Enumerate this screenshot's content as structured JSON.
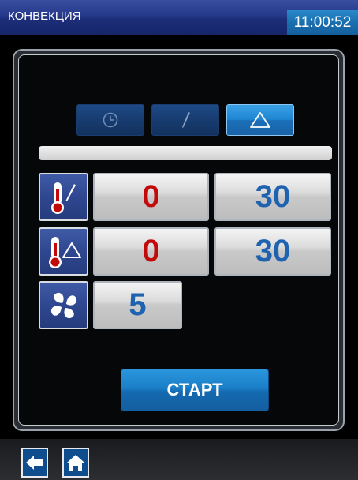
{
  "header": {
    "title": "КОНВЕКЦИЯ",
    "time": "11:00:52"
  },
  "modes": [
    {
      "icon": "clock-icon",
      "active": false
    },
    {
      "icon": "probe-icon",
      "active": false
    },
    {
      "icon": "delta-icon",
      "active": true
    }
  ],
  "progress": {
    "value": 0
  },
  "rows": [
    {
      "icon": "thermometer-probe-icon",
      "left_value": "0",
      "right_value": "30"
    },
    {
      "icon": "thermometer-delta-icon",
      "left_value": "0",
      "right_value": "30"
    },
    {
      "icon": "fan-icon",
      "left_value": "5"
    }
  ],
  "start_label": "СТАРТ",
  "nav": [
    {
      "icon": "back-arrow-icon"
    },
    {
      "icon": "home-icon"
    }
  ],
  "colors": {
    "accent_blue": "#1f86d3",
    "value_red": "#c20a0a",
    "value_blue": "#1f62b0"
  }
}
